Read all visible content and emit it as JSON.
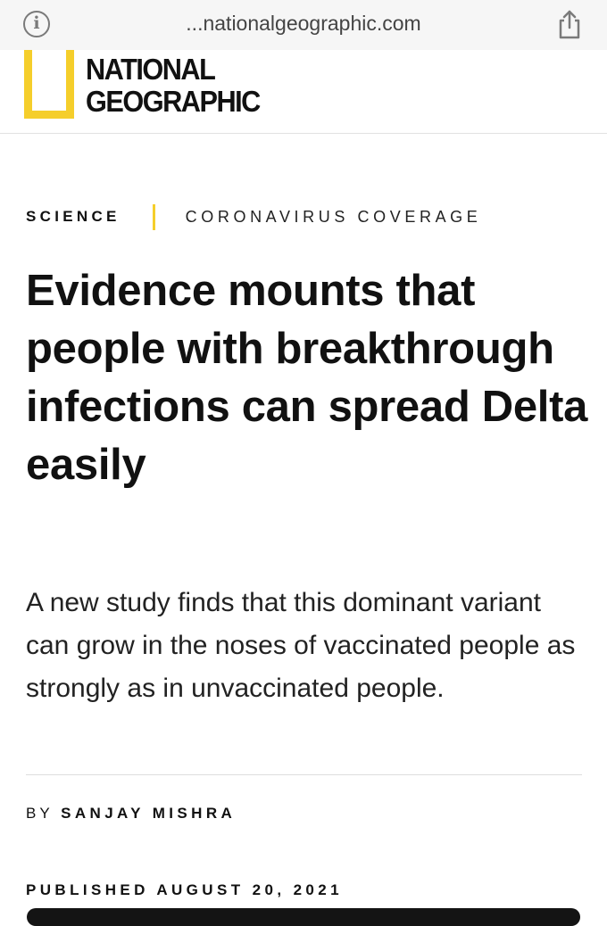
{
  "browser": {
    "url": "...nationalgeographic.com",
    "info_icon": "info-circle-icon",
    "share_icon": "share-icon"
  },
  "header": {
    "logo_line1": "NATIONAL",
    "logo_line2": "GEOGRAPHIC",
    "logo_color": "#f5ce2b"
  },
  "article": {
    "section": "SCIENCE",
    "topic": "CORONAVIRUS COVERAGE",
    "headline": "Evidence mounts that people with breakthrough infections can spread Delta easily",
    "dek": "A new study finds that this dominant variant can grow in the noses of vaccinated people as strongly as in unvaccinated people.",
    "byline_prefix": "BY",
    "author": "SANJAY MISHRA",
    "published": "PUBLISHED AUGUST 20, 2021"
  }
}
